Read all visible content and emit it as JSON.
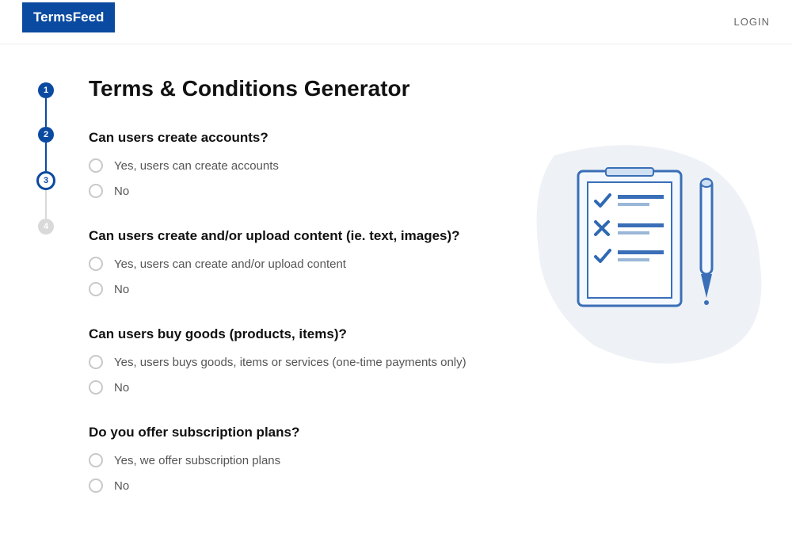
{
  "header": {
    "logo_part1": "Terms",
    "logo_part2": "Feed",
    "login": "LOGIN"
  },
  "steps": {
    "s1": "1",
    "s2": "2",
    "s3": "3",
    "s4": "4"
  },
  "title": "Terms & Conditions Generator",
  "questions": [
    {
      "title": "Can users create accounts?",
      "opt_yes": "Yes, users can create accounts",
      "opt_no": "No"
    },
    {
      "title": "Can users create and/or upload content (ie. text, images)?",
      "opt_yes": "Yes, users can create and/or upload content",
      "opt_no": "No"
    },
    {
      "title": "Can users buy goods (products, items)?",
      "opt_yes": "Yes, users buys goods, items or services (one-time payments only)",
      "opt_no": "No"
    },
    {
      "title": "Do you offer subscription plans?",
      "opt_yes": "Yes, we offer subscription plans",
      "opt_no": "No"
    }
  ]
}
